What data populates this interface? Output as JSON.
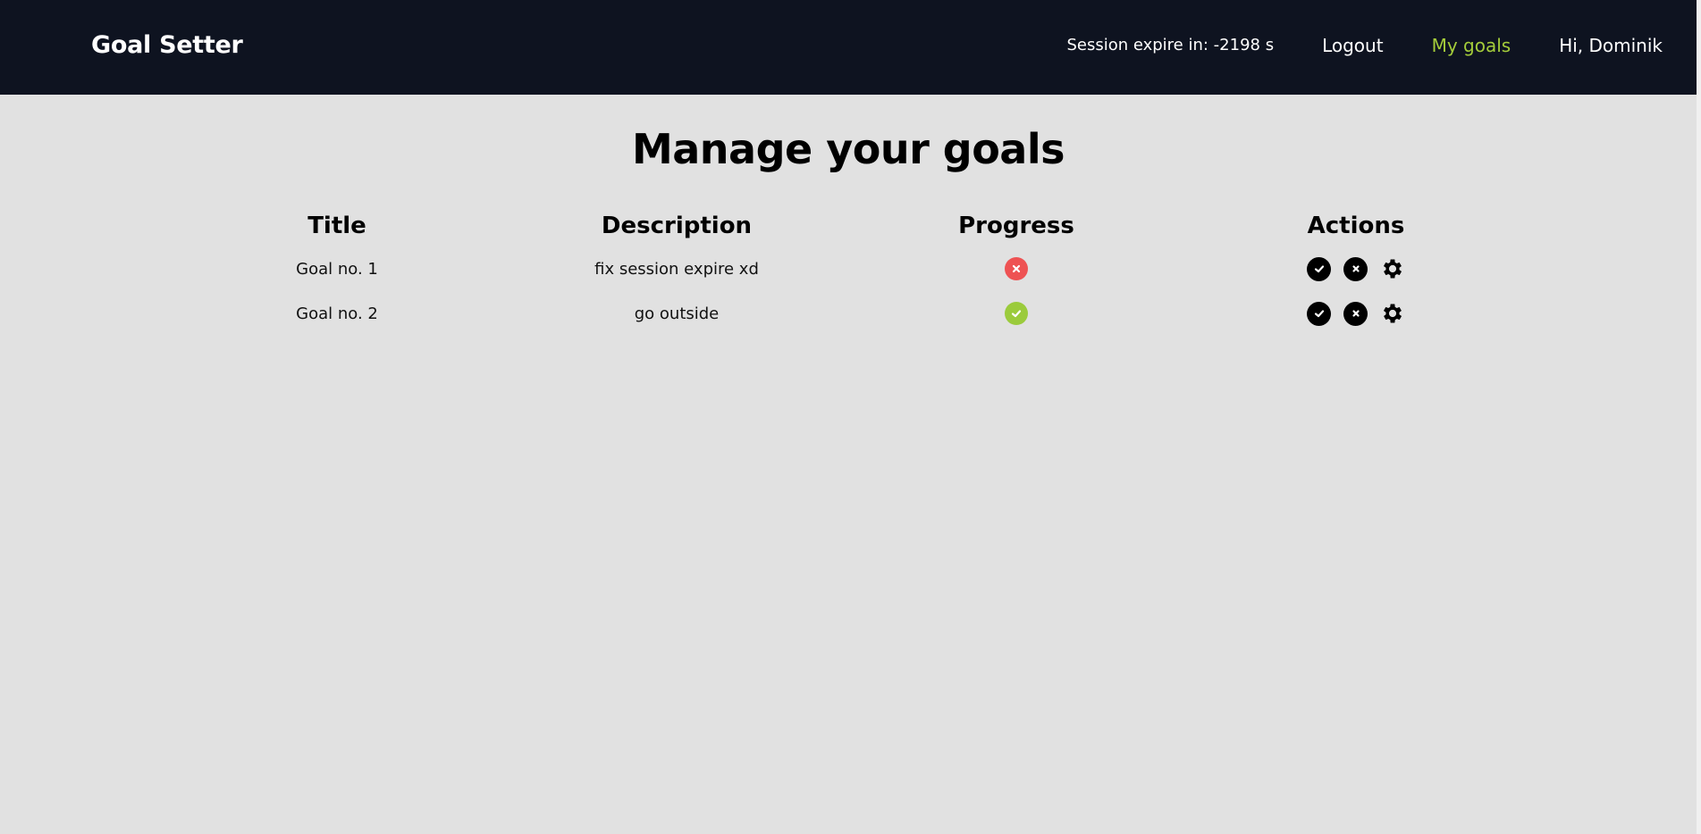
{
  "header": {
    "brand": "Goal Setter",
    "session_text": "Session expire in: -2198 s",
    "logout_label": "Logout",
    "my_goals_label": "My goals",
    "greeting": "Hi, Dominik"
  },
  "main": {
    "title": "Manage your goals",
    "columns": [
      "Title",
      "Description",
      "Progress",
      "Actions"
    ],
    "goals": [
      {
        "title": "Goal no. 1",
        "description": "fix session expire xd",
        "progress": "not-completed"
      },
      {
        "title": "Goal no. 2",
        "description": "go outside",
        "progress": "completed"
      }
    ]
  },
  "colors": {
    "header_bg": "#0e1320",
    "page_bg": "#e1e1e1",
    "accent_green": "#a4cc3a",
    "status_done": "#9bcb3c",
    "status_fail": "#ee5253"
  },
  "icons": {
    "progress_fail": "x-circle-icon",
    "progress_done": "check-circle-icon",
    "action_complete": "check-circle-icon",
    "action_delete": "x-circle-icon",
    "action_edit": "gear-icon"
  }
}
